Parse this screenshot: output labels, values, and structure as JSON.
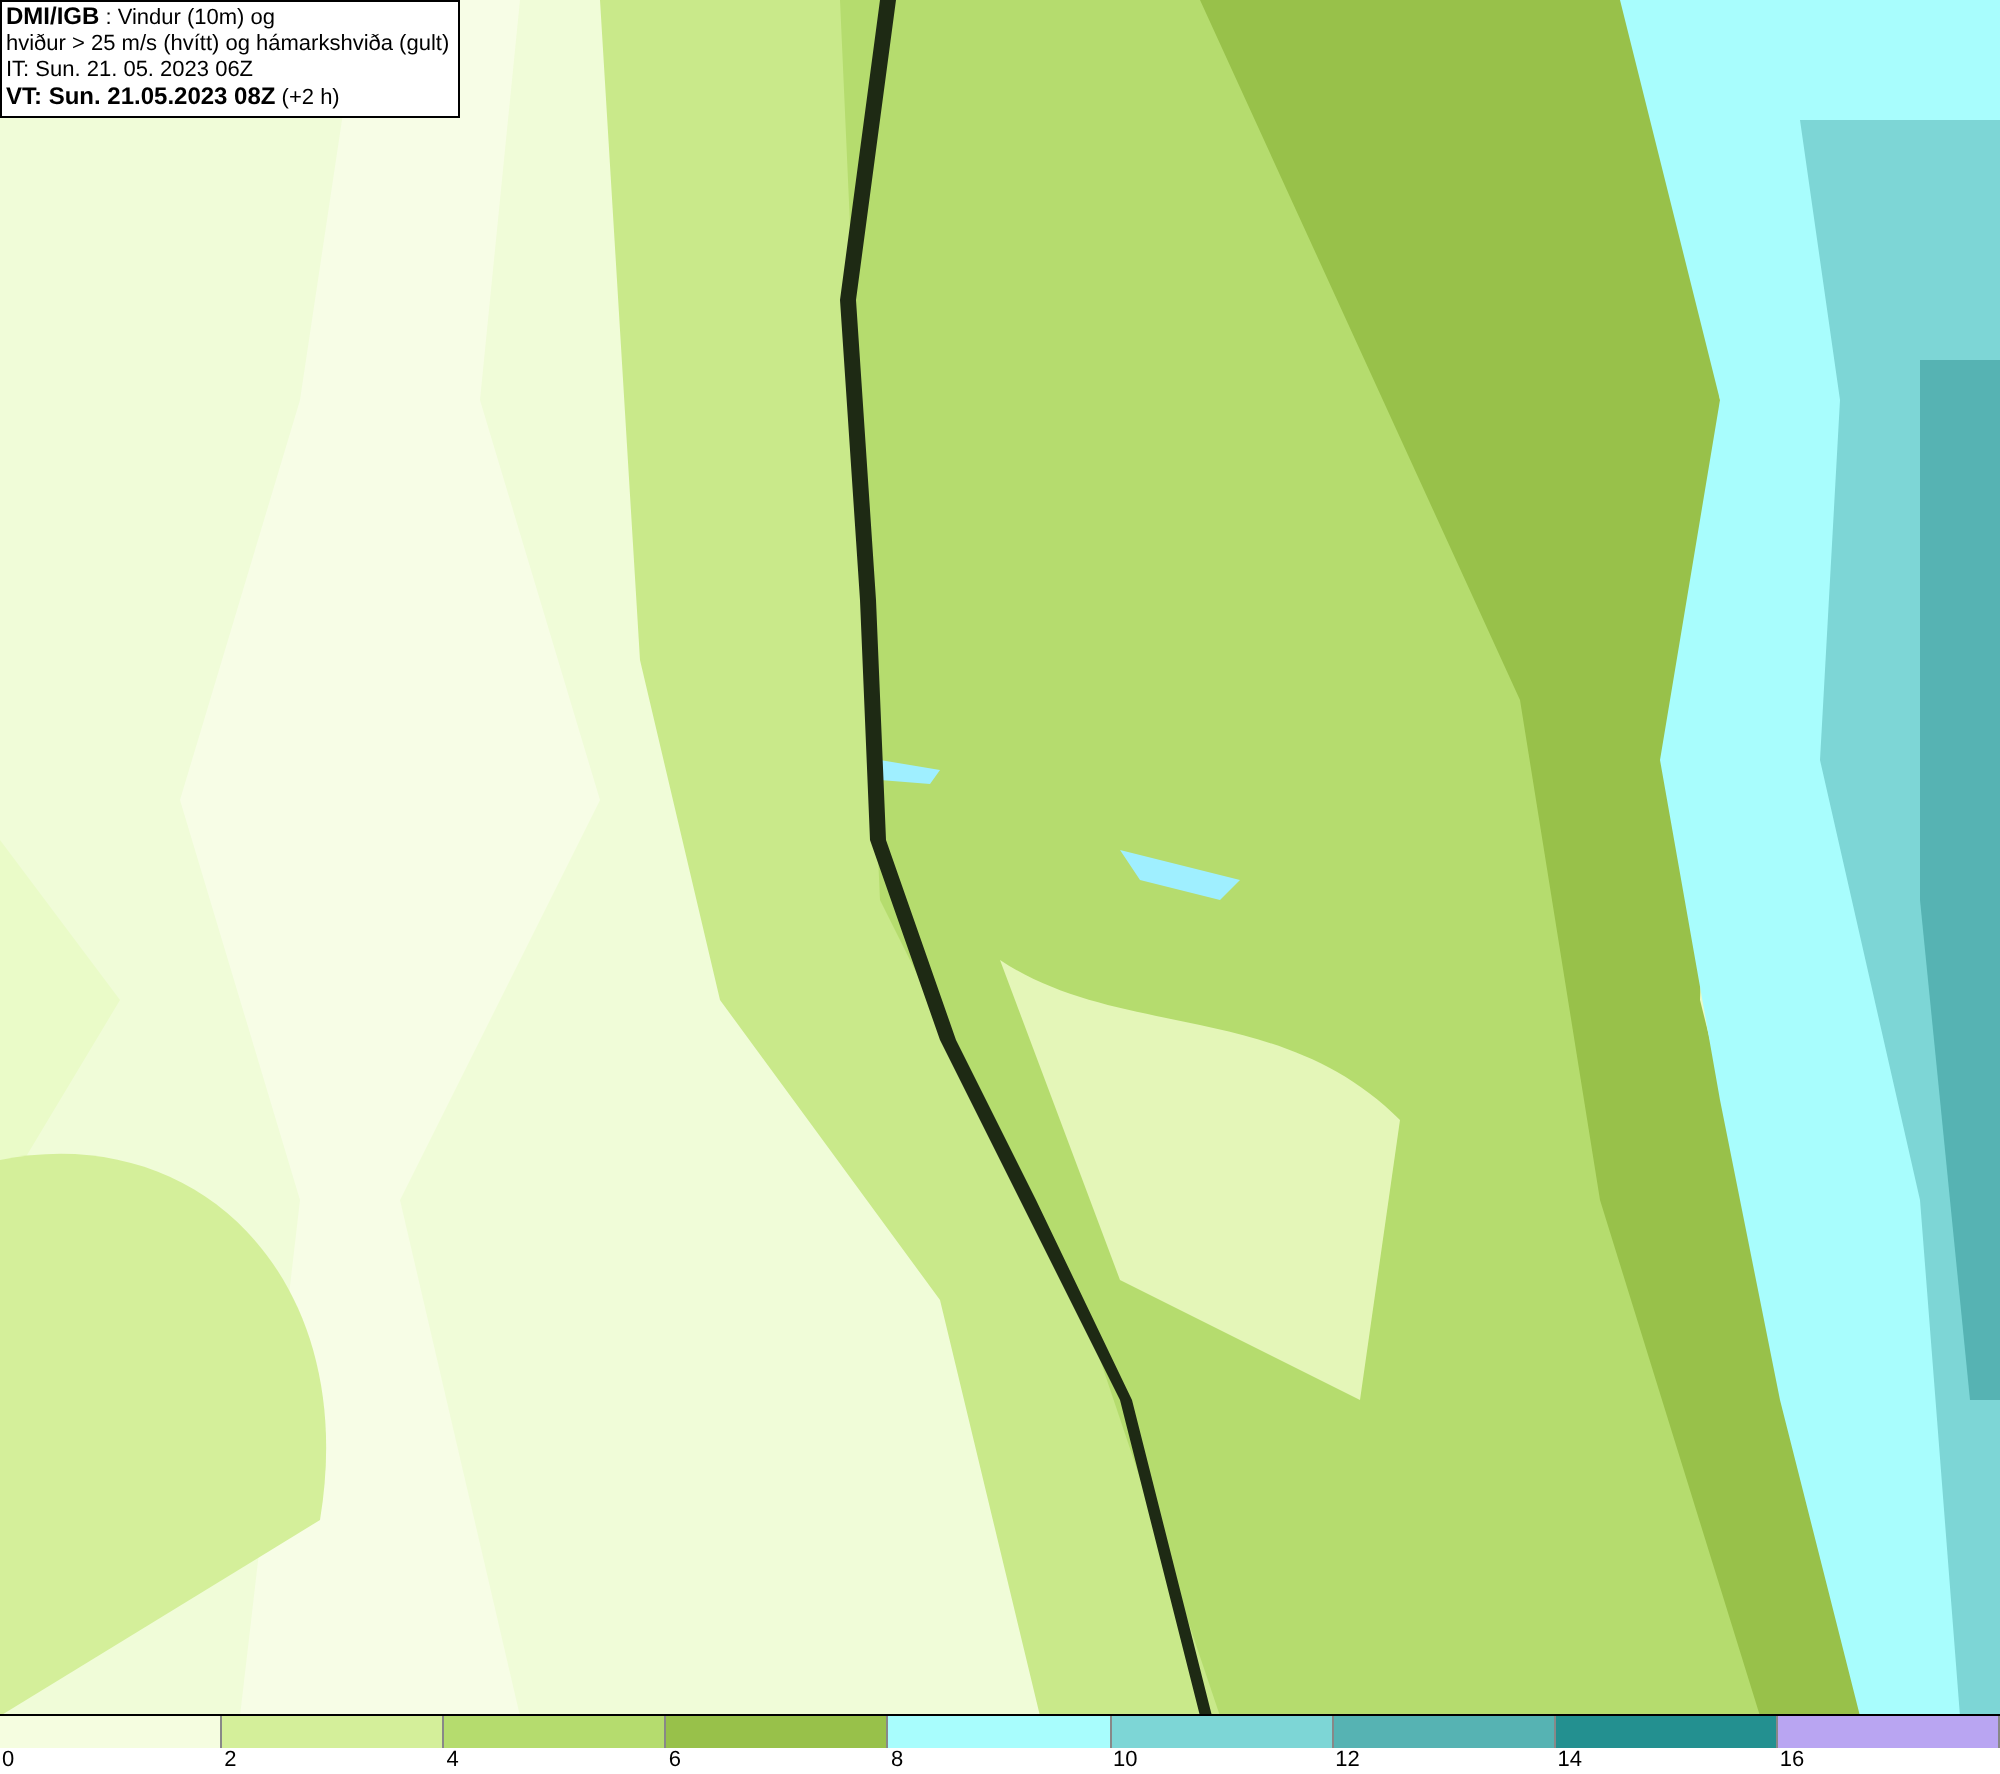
{
  "header": {
    "lines": [
      "**DMI/IGB** : Vindur (10m) og",
      "hviður > 25 m/s (hvítt) og hámarkshviða (gult)",
      "IT: Sun. 21. 05. 2023 06Z",
      "**VT: Sun. 21.05.2023 08Z** (+2 h)"
    ]
  },
  "legend": [
    {
      "color": "#f5fde0",
      "label": "0"
    },
    {
      "color": "#d4ef9a",
      "label": "2"
    },
    {
      "color": "#b5dc6e",
      "label": "4"
    },
    {
      "color": "#98c14a",
      "label": "6"
    },
    {
      "color": "#a8fdfd",
      "label": "8"
    },
    {
      "color": "#7dd6d6",
      "label": "10"
    },
    {
      "color": "#56b3b3",
      "label": "12"
    },
    {
      "color": "#239090",
      "label": "14"
    },
    {
      "color": "#b9a5f2",
      "label": "16"
    }
  ]
}
